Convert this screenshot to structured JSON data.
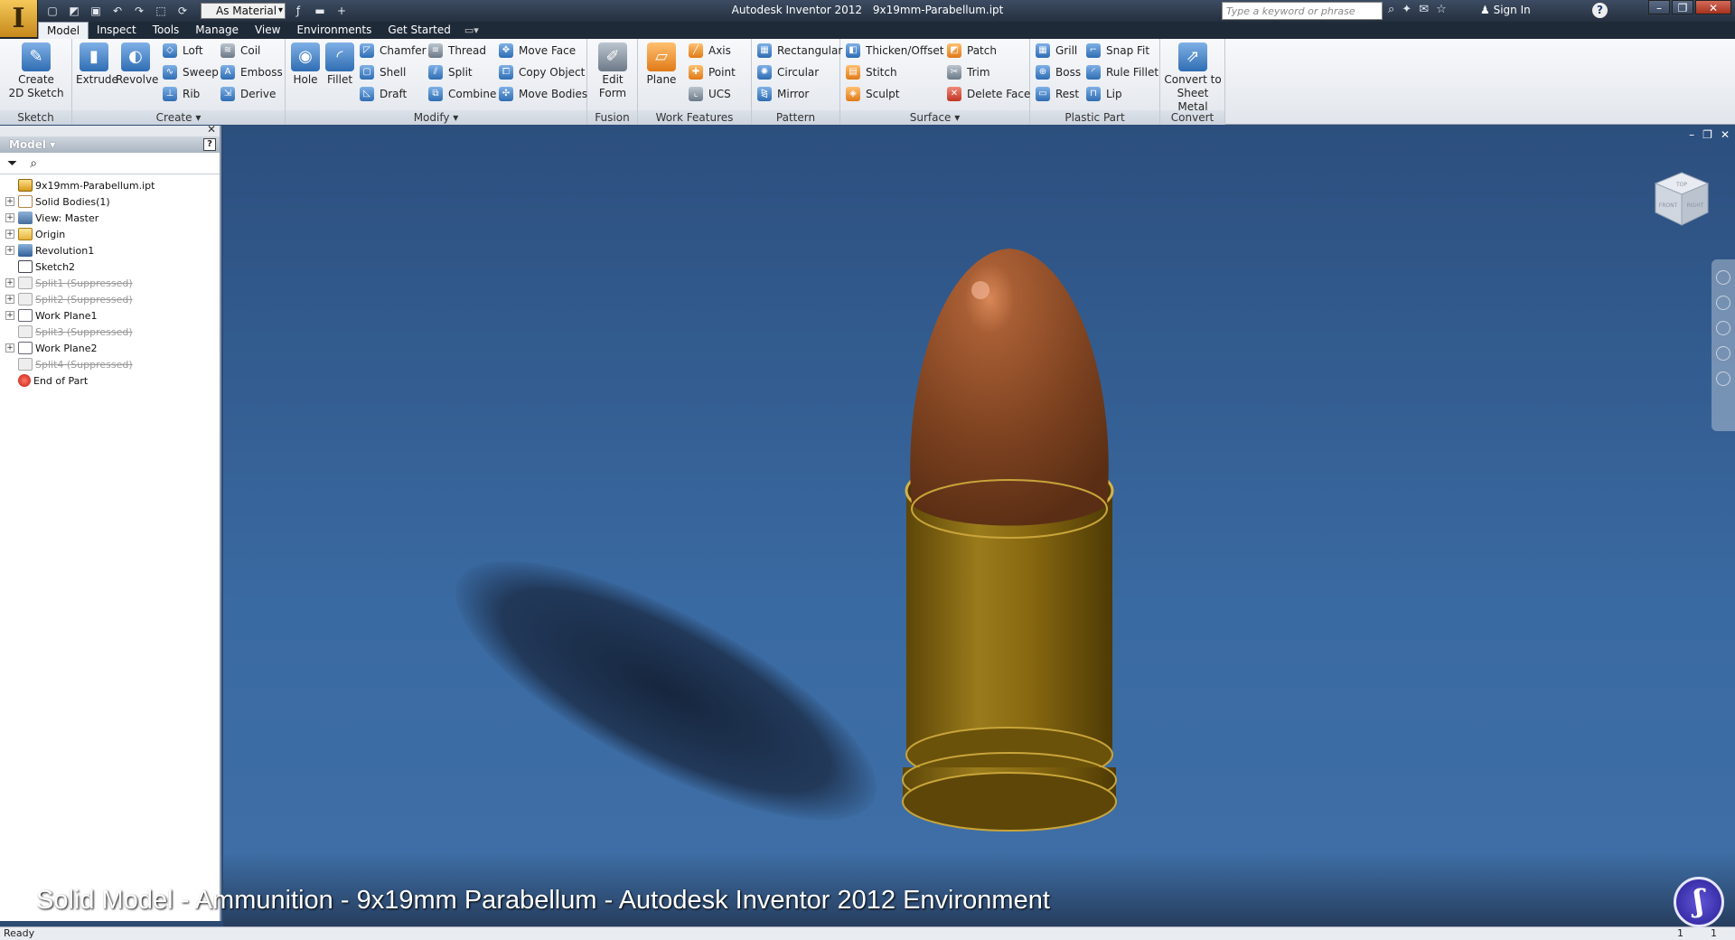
{
  "app": {
    "logo": "I",
    "title": "Autodesk Inventor 2012",
    "document": "9x19mm-Parabellum.ipt"
  },
  "qat": {
    "material": "As Material",
    "icons": [
      "new-icon",
      "open-icon",
      "save-icon",
      "undo-icon",
      "redo-icon",
      "select-icon",
      "update-icon",
      "fx-icon"
    ]
  },
  "search": {
    "placeholder": "Type a keyword or phrase"
  },
  "account": {
    "signin": "Sign In",
    "help": "?"
  },
  "tabs": [
    "Model",
    "Inspect",
    "Tools",
    "Manage",
    "View",
    "Environments",
    "Get Started"
  ],
  "ribbon": {
    "sketch": {
      "label": "Sketch",
      "create_2d": "Create\n2D Sketch"
    },
    "create": {
      "label": "Create ▾",
      "extrude": "Extrude",
      "revolve": "Revolve",
      "loft": "Loft",
      "sweep": "Sweep",
      "rib": "Rib",
      "coil": "Coil",
      "emboss": "Emboss",
      "derive": "Derive"
    },
    "modify": {
      "label": "Modify ▾",
      "hole": "Hole",
      "fillet": "Fillet",
      "chamfer": "Chamfer",
      "shell": "Shell",
      "draft": "Draft",
      "thread": "Thread",
      "split": "Split",
      "combine": "Combine",
      "move_face": "Move Face",
      "copy_object": "Copy Object",
      "move_bodies": "Move Bodies"
    },
    "fusion": {
      "label": "Fusion",
      "edit_form": "Edit\nForm"
    },
    "work_features": {
      "label": "Work Features",
      "plane": "Plane",
      "axis": "Axis",
      "point": "Point",
      "ucs": "UCS"
    },
    "pattern": {
      "label": "Pattern",
      "rectangular": "Rectangular",
      "circular": "Circular",
      "mirror": "Mirror"
    },
    "surface": {
      "label": "Surface ▾",
      "thicken": "Thicken/Offset",
      "stitch": "Stitch",
      "sculpt": "Sculpt",
      "patch": "Patch",
      "trim": "Trim",
      "delete_face": "Delete Face"
    },
    "plastic_part": {
      "label": "Plastic Part",
      "grill": "Grill",
      "boss": "Boss",
      "rest": "Rest",
      "snap_fit": "Snap Fit",
      "rule_fillet": "Rule Fillet",
      "lip": "Lip"
    },
    "convert": {
      "label": "Convert",
      "sheet_metal": "Convert to\nSheet Metal"
    }
  },
  "browser": {
    "title": "Model ▾",
    "tree": [
      {
        "label": "9x19mm-Parabellum.ipt",
        "icon": "part",
        "expand": ""
      },
      {
        "label": "Solid Bodies(1)",
        "icon": "body",
        "expand": "+"
      },
      {
        "label": "View: Master",
        "icon": "view",
        "expand": "+"
      },
      {
        "label": "Origin",
        "icon": "folder",
        "expand": "+"
      },
      {
        "label": "Revolution1",
        "icon": "rev",
        "expand": "+"
      },
      {
        "label": "Sketch2",
        "icon": "sketch",
        "expand": ""
      },
      {
        "label": "Split1 (Suppressed)",
        "icon": "sup",
        "expand": "+"
      },
      {
        "label": "Split2 (Suppressed)",
        "icon": "sup",
        "expand": "+"
      },
      {
        "label": "Work Plane1",
        "icon": "plane",
        "expand": "+"
      },
      {
        "label": "Split3 (Suppressed)",
        "icon": "sup",
        "expand": ""
      },
      {
        "label": "Work Plane2",
        "icon": "plane",
        "expand": "+"
      },
      {
        "label": "Split4 (Suppressed)",
        "icon": "sup",
        "expand": ""
      },
      {
        "label": "End of Part",
        "icon": "end",
        "expand": ""
      }
    ]
  },
  "viewcube": {
    "top": "TOP",
    "front": "FRONT",
    "right": "RIGHT"
  },
  "caption": "Solid Model - Ammunition - 9x19mm Parabellum - Autodesk Inventor 2012 Environment",
  "status": {
    "text": "Ready",
    "num1": "1",
    "num2": "1"
  },
  "colors": {
    "brass": "#8a6a14",
    "copper": "#8a4a22",
    "viewport": "#3a6aa2"
  }
}
